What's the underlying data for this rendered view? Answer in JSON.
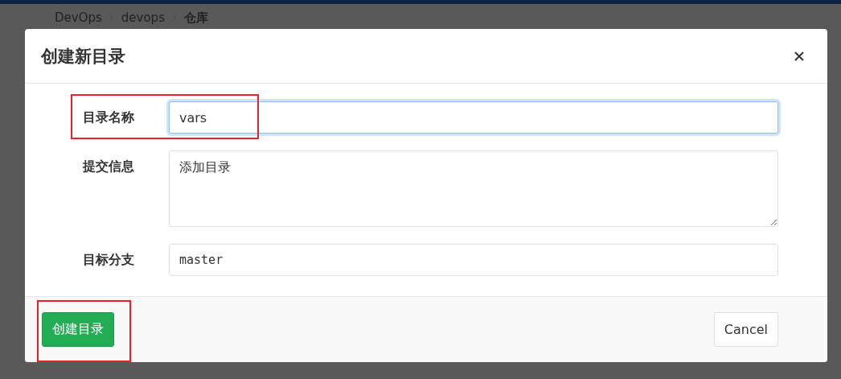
{
  "breadcrumb": [
    {
      "label": "DevOps",
      "current": false
    },
    {
      "label": "devops",
      "current": false
    },
    {
      "label": "仓库",
      "current": true
    }
  ],
  "dialog": {
    "title": "创建新目录",
    "fields": [
      {
        "kind": "input",
        "label": "目录名称",
        "value": "vars",
        "focused": true,
        "mono": false
      },
      {
        "kind": "textarea",
        "label": "提交信息",
        "value": "添加目录",
        "focused": false,
        "mono": false
      },
      {
        "kind": "input",
        "label": "目标分支",
        "value": "master",
        "focused": false,
        "mono": true
      }
    ],
    "buttons": [
      {
        "kind": "primary",
        "label": "创建目录"
      },
      {
        "kind": "default",
        "label": "Cancel"
      }
    ]
  }
}
